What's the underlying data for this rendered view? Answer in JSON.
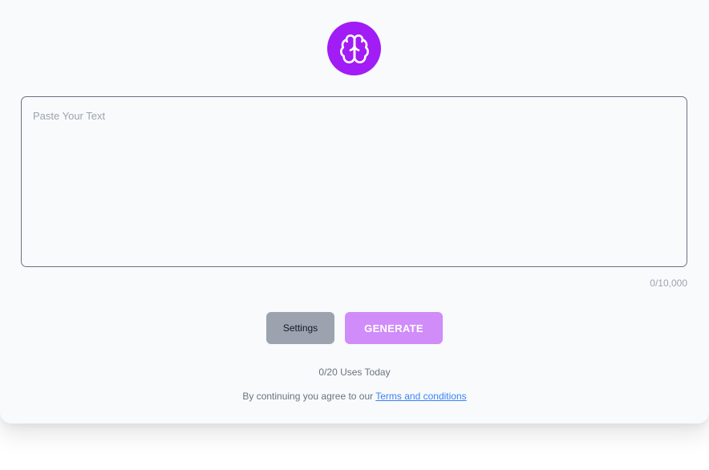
{
  "logo": {
    "icon": "brain-icon",
    "color": "#a11cf5"
  },
  "editor": {
    "placeholder": "Paste Your Text",
    "value": "",
    "char_count": "0/10,000"
  },
  "buttons": {
    "settings_label": "Settings",
    "settings_color": "#9ca3af",
    "generate_label": "GENERATE",
    "generate_color": "#d08cf9"
  },
  "usage": {
    "text": "0/20 Uses Today"
  },
  "terms": {
    "prefix": "By continuing you agree to our",
    "link_label": "Terms and conditions",
    "link_color": "#3b82f6"
  }
}
